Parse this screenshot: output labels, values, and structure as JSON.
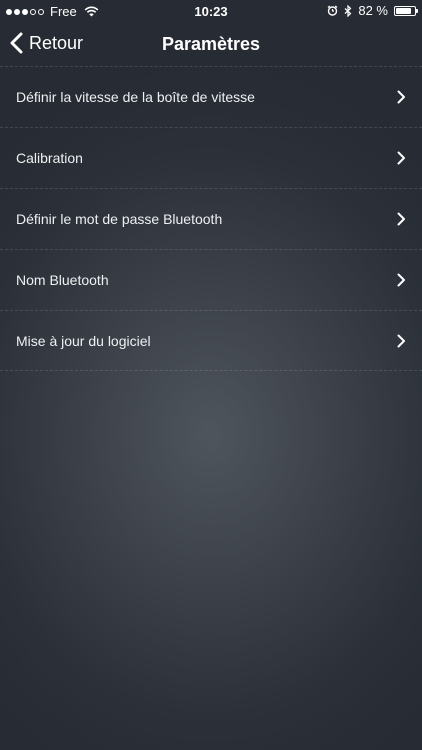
{
  "status_bar": {
    "carrier": "Free",
    "time": "10:23",
    "battery_text": "82 %",
    "battery_level": 0.82,
    "icons": [
      "signal-dots",
      "wifi-icon",
      "alarm-icon",
      "bluetooth-icon",
      "battery-icon"
    ]
  },
  "nav": {
    "back_label": "Retour",
    "title": "Paramètres"
  },
  "menu": {
    "items": [
      {
        "label": "Définir la vitesse de la boîte de vitesse"
      },
      {
        "label": "Calibration"
      },
      {
        "label": "Définir le mot de passe Bluetooth"
      },
      {
        "label": "Nom Bluetooth"
      },
      {
        "label": "Mise à jour du logiciel"
      }
    ]
  },
  "colors": {
    "background_center": "#4f555d",
    "background_edge": "#272b33",
    "text": "#ffffff"
  }
}
